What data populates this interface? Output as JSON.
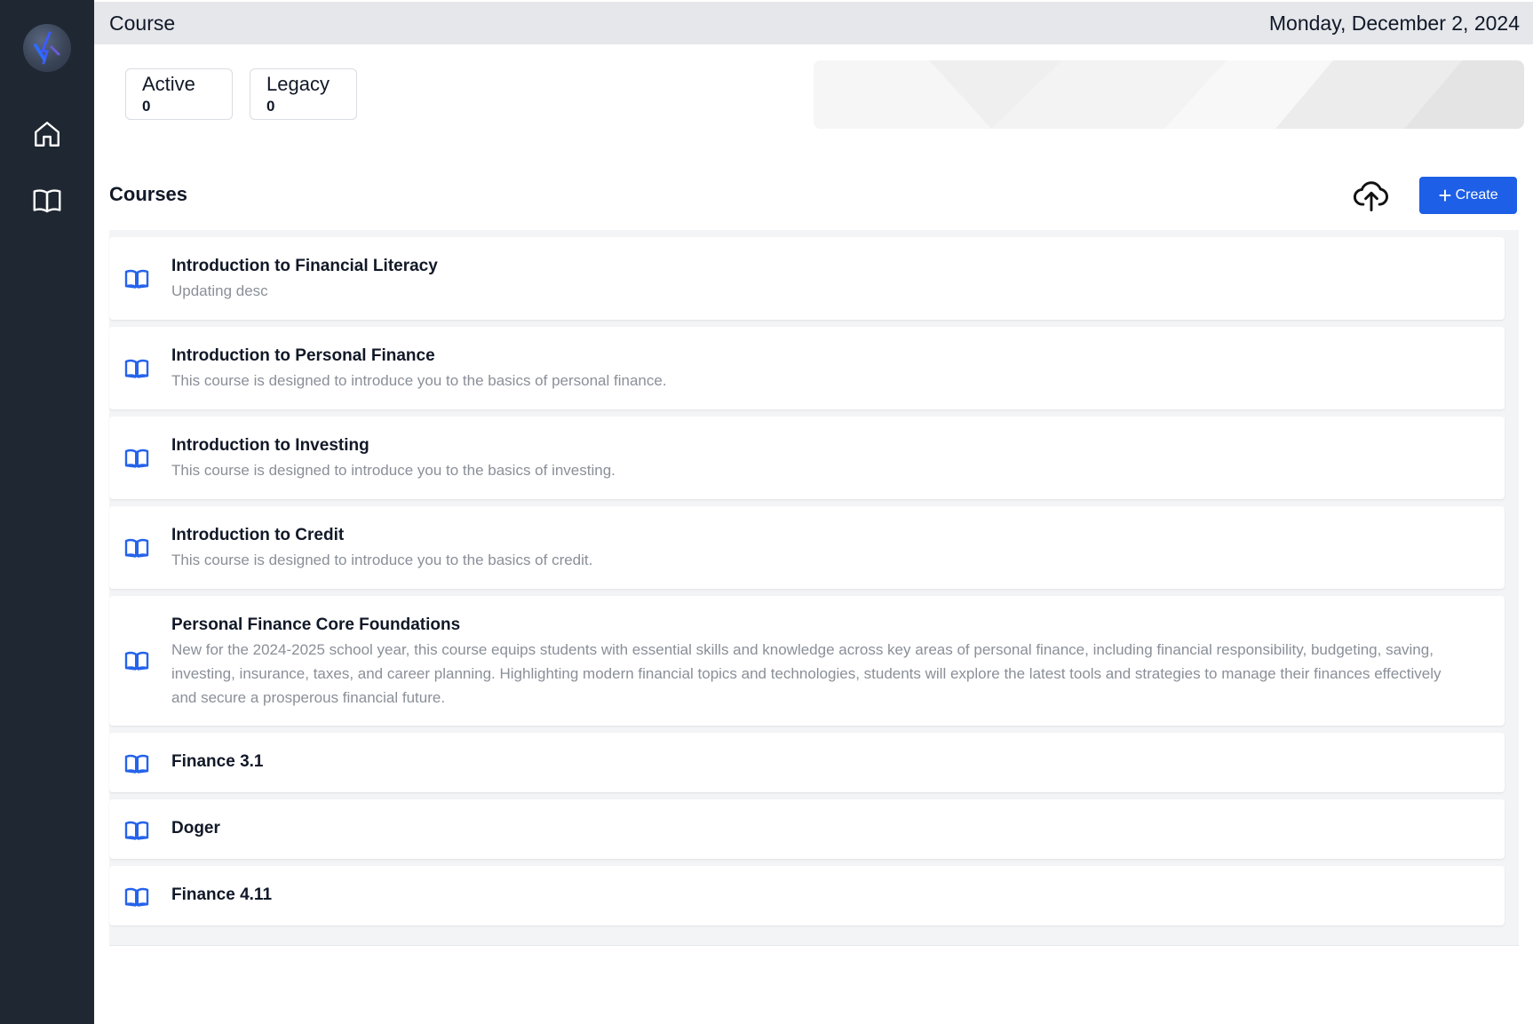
{
  "header": {
    "title": "Course",
    "date": "Monday, December 2, 2024"
  },
  "stats": [
    {
      "label": "Active",
      "value": "0"
    },
    {
      "label": "Legacy",
      "value": "0"
    }
  ],
  "section": {
    "title": "Courses",
    "create_label": "Create"
  },
  "icons": {
    "logo": "logo-icon",
    "home": "home-icon",
    "book": "book-open-icon",
    "upload": "cloud-upload-icon",
    "plus": "plus-icon"
  },
  "colors": {
    "sidebar": "#1f2732",
    "accent": "#1d5fe6",
    "topbar": "#e5e7eb"
  },
  "courses": [
    {
      "title": "Introduction to Financial Literacy",
      "desc": "Updating desc"
    },
    {
      "title": "Introduction to Personal Finance",
      "desc": "This course is designed to introduce you to the basics of personal finance."
    },
    {
      "title": "Introduction to Investing",
      "desc": "This course is designed to introduce you to the basics of investing."
    },
    {
      "title": "Introduction to Credit",
      "desc": "This course is designed to introduce you to the basics of credit."
    },
    {
      "title": "Personal Finance Core Foundations",
      "desc": "New for the 2024-2025 school year, this course equips students with essential skills and knowledge across key areas of personal finance, including financial responsibility, budgeting, saving, investing, insurance, taxes, and career planning. Highlighting modern financial topics and technologies, students will explore the latest tools and strategies to manage their finances effectively and secure a prosperous financial future."
    },
    {
      "title": "Finance 3.1",
      "desc": ""
    },
    {
      "title": "Doger",
      "desc": ""
    },
    {
      "title": "Finance 4.11",
      "desc": ""
    }
  ]
}
